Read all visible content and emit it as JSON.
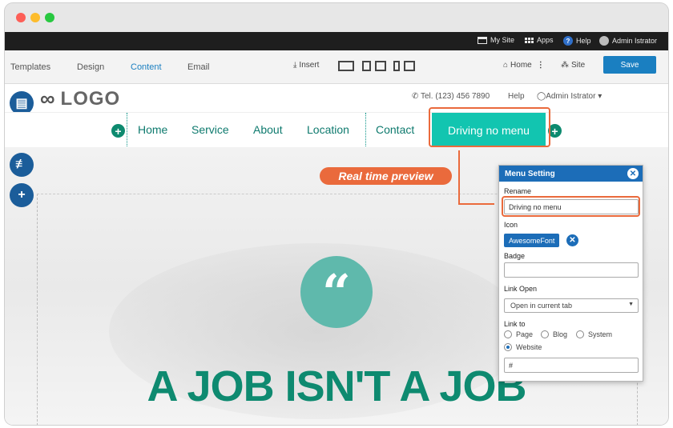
{
  "colors": {
    "accent": "#1a7fc1",
    "brand_green": "#0e8a70",
    "active_nav": "#12c5b0",
    "highlight": "#ea6a3c",
    "panel_blue": "#1c6db8"
  },
  "topbar": {
    "my_site": "My Site",
    "apps": "Apps",
    "help": "Help",
    "user": "Admin Istrator"
  },
  "toolbar": {
    "tabs": [
      "Templates",
      "Design",
      "Content",
      "Email"
    ],
    "active_tab": "Content",
    "insert_label": "Insert",
    "home_label": "Home",
    "site_label": "Site",
    "save_label": "Save"
  },
  "header": {
    "logo_text": "LOGO",
    "phone": "Tel. (123) 456 7890",
    "help": "Help",
    "user": "Admin Istrator"
  },
  "nav": {
    "items": [
      "Home",
      "Service",
      "About",
      "Location",
      "Contact"
    ],
    "active_item": "Driving no menu"
  },
  "hero": {
    "quote_glyph": "“",
    "title": "A JOB ISN'T A JOB"
  },
  "callout": "Real time preview",
  "panel": {
    "title": "Menu Setting",
    "rename_label": "Rename",
    "rename_value": "Driving no menu",
    "icon_label": "Icon",
    "icon_value": "AwesomeFont",
    "badge_label": "Badge",
    "badge_value": "",
    "link_open_label": "Link Open",
    "link_open_value": "Open in current tab",
    "link_to_label": "Link to",
    "link_options": [
      "Page",
      "Blog",
      "System",
      "Website"
    ],
    "link_selected": "Website",
    "url_value": "#"
  }
}
